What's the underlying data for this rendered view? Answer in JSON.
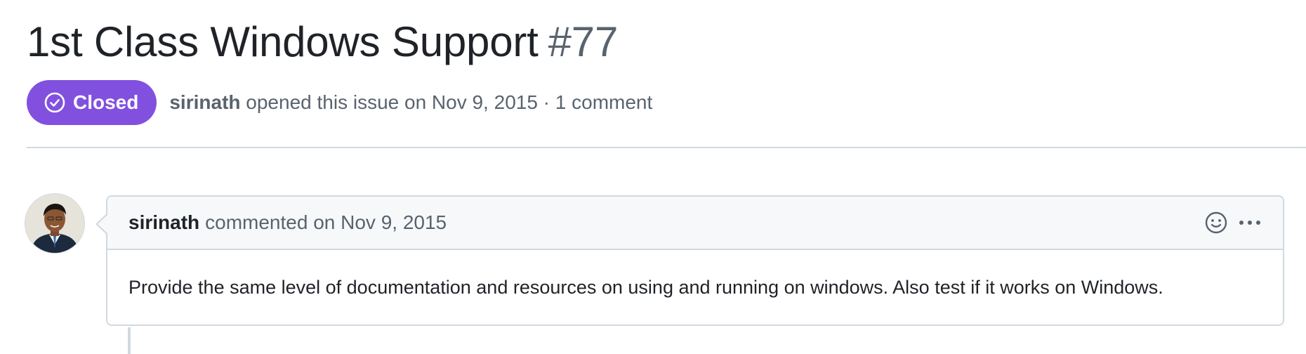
{
  "issue": {
    "title": "1st Class Windows Support",
    "number": "#77",
    "state": "Closed",
    "state_color": "#8250df",
    "state_icon": "check-circle-icon",
    "author": "sirinath",
    "opened_text": "opened this issue on Nov 9, 2015 · 1 comment"
  },
  "comment": {
    "author": "sirinath",
    "action_text": "commented on Nov 9, 2015",
    "body": "Provide the same level of documentation and resources on using and running on windows. Also test if it works on Windows.",
    "reaction_icon": "smiley-icon",
    "menu_icon": "kebab-horizontal-icon"
  }
}
